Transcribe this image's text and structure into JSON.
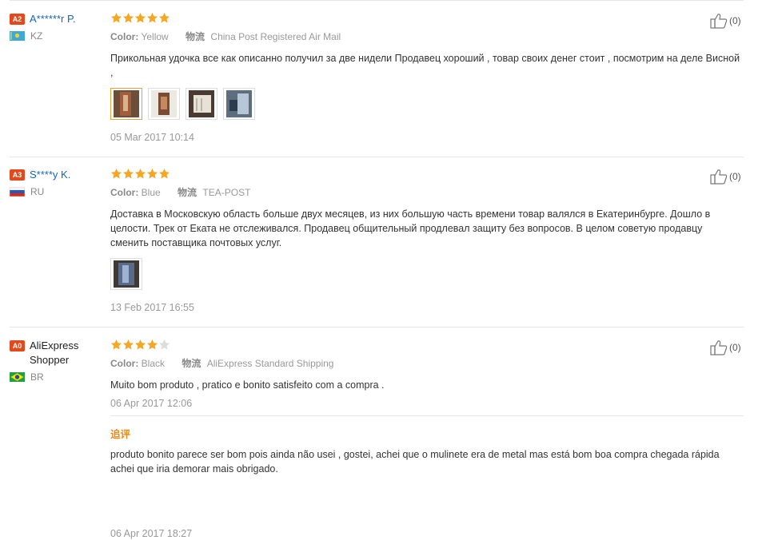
{
  "helpful_label": "(0)",
  "append_label": "追评",
  "reviews": [
    {
      "level": "A2",
      "name": "A******r P.",
      "country": "KZ",
      "stars": 5,
      "color_label": "Color:",
      "color": "Yellow",
      "logistics_label": "物流",
      "logistics": "China Post Registered Air Mail",
      "text": "Прикольная удочка все как описанно получил за две нидели Продавец хороший , товар своих денег стоит , посмотрим на деле Висной ,",
      "photos": 4,
      "date": "05 Mar 2017 10:14"
    },
    {
      "level": "A3",
      "name": "S****y K.",
      "country": "RU",
      "stars": 5,
      "color_label": "Color:",
      "color": "Blue",
      "logistics_label": "物流",
      "logistics": "TEA-POST",
      "text": "Доставка в Московскую область больше двух месяцев, из них большую часть времени товар валялся в Екатеринбурге. Дошло в целости. Трек от Еката не отслеживался. Продавец общительный продлевал защиту без вопросов. В целом советую продавцу сменить поставщика почтовых услуг.",
      "photos": 1,
      "date": "13 Feb 2017 16:55"
    },
    {
      "level": "A0",
      "name": "AliExpress Shopper",
      "country": "BR",
      "stars": 4,
      "color_label": "Color:",
      "color": "Black",
      "logistics_label": "物流",
      "logistics": "AliExpress Standard Shipping",
      "text": "Muito bom produto , pratico e bonito satisfeito com a compra .",
      "date": "06 Apr 2017 12:06",
      "append_text": "produto bonito parece ser bom pois ainda não usei , gostei, achei que o mulinete era de metal mas está bom boa compra chegada rápida achei que iria demorar mais obrigado.",
      "append_date": "06 Apr 2017 18:27"
    }
  ],
  "colors": {
    "star": "#f5a623",
    "star_empty": "#dddddd",
    "badge": "#e24a1d",
    "link": "#1a64b5",
    "append": "#e88a1a"
  }
}
